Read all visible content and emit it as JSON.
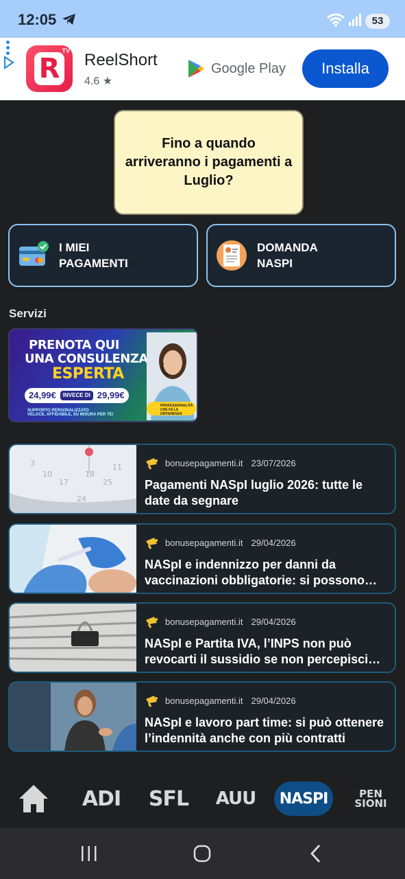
{
  "status_bar": {
    "time": "12:05",
    "battery": "53"
  },
  "ad": {
    "app_name": "ReelShort",
    "rating": "4.6 ★",
    "store_label": "Google Play",
    "install_label": "Installa",
    "icon_badge": "TV",
    "icon_letter": "R"
  },
  "question": {
    "text": "Fino a quando arriveranno i pagamenti a Luglio?"
  },
  "quick_buttons": [
    {
      "label": "I MIEI\nPAGAMENTI"
    },
    {
      "label": "DOMANDA\nNASPI"
    }
  ],
  "services": {
    "title": "Servizi",
    "promo": {
      "line1": "PRENOTA QUI",
      "line2": "UNA CONSULENZA",
      "line3": "ESPERTA",
      "price": "24,99€",
      "instead": "INVECE DI",
      "old_price": "29,99€",
      "support": "SUPPORTO PERSONALIZZATO",
      "support_sub": "VELOCE, AFFIDABILE, SU MISURA PER TE!",
      "badge": "PROFESSIONALITÀ CHE FA LA DIFFERENZA"
    }
  },
  "news": [
    {
      "source": "bonusepagamenti.it",
      "date": "23/07/2026",
      "title": "Pagamenti NASpI luglio 2026: tutte le date da segnare"
    },
    {
      "source": "bonusepagamenti.it",
      "date": "29/04/2026",
      "title": "NASpI e indennizzo per danni da vaccinazioni obbligatorie: si possono cumulare?"
    },
    {
      "source": "bonusepagamenti.it",
      "date": "29/04/2026",
      "title": "NASpI e Partita IVA, l’INPS non può revocarti il sussidio se non percepisci reddito"
    },
    {
      "source": "bonusepagamenti.it",
      "date": "29/04/2026",
      "title": "NASpI e lavoro part time: si può ottenere l’indennità anche con più contratti"
    }
  ],
  "tabs": {
    "adi": "ADI",
    "sfl": "SFL",
    "auu": "AUU",
    "naspi": "NASPI",
    "pen1": "PEN",
    "pen2": "SIONI"
  },
  "colors": {
    "background": "#1e1f21",
    "status_bar": "#a7cdfa",
    "accent_border": "#8cc3f0",
    "question_bg": "#fdf5c6",
    "active_tab": "#0f4d86",
    "install_button": "#0b57d0"
  }
}
